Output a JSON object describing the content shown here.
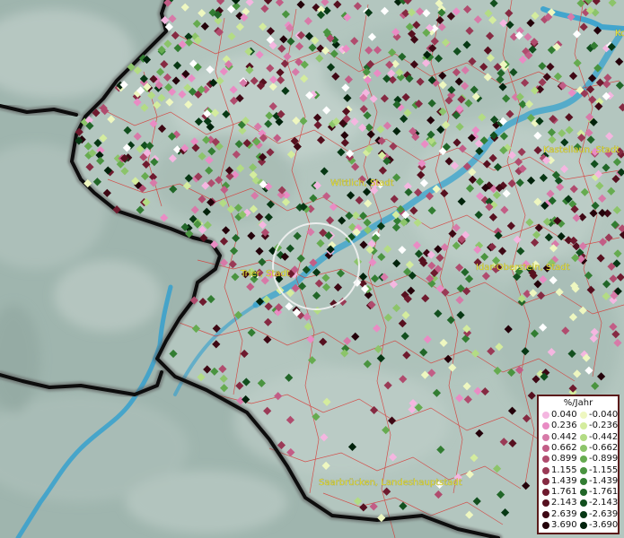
{
  "map": {
    "places": [
      {
        "name": "Wittlich, Stadt"
      },
      {
        "name": "Kastellaun, Stadt"
      },
      {
        "name": "Trier, Stadt"
      },
      {
        "name": "Idar-Oberstein, Stadt"
      },
      {
        "name": "Saarbrücken, Landeshauptstadt"
      },
      {
        "name": "Ko"
      }
    ],
    "colors": {
      "terrain": "#a9bcb6",
      "border": "#111111",
      "admin_lines": "#d9322e",
      "rivers": "#2a9fd0"
    }
  },
  "legend": {
    "title": "%/Jahr",
    "positive": [
      {
        "value": "0.040",
        "color": "#f4b6e0"
      },
      {
        "value": "0.236",
        "color": "#e98cc4"
      },
      {
        "value": "0.442",
        "color": "#d77aa8"
      },
      {
        "value": "0.662",
        "color": "#c25d86"
      },
      {
        "value": "0.899",
        "color": "#b04c6e"
      },
      {
        "value": "1.155",
        "color": "#9a3a56"
      },
      {
        "value": "1.439",
        "color": "#852a42"
      },
      {
        "value": "1.761",
        "color": "#6e1a2e"
      },
      {
        "value": "2.143",
        "color": "#56101f"
      },
      {
        "value": "2.639",
        "color": "#3e0814"
      },
      {
        "value": "3.690",
        "color": "#24020a"
      }
    ],
    "negative": [
      {
        "value": "-0.040",
        "color": "#eef7c0"
      },
      {
        "value": "-0.236",
        "color": "#d4ec9e"
      },
      {
        "value": "-0.442",
        "color": "#b3dc84"
      },
      {
        "value": "-0.662",
        "color": "#8cc46a"
      },
      {
        "value": "-0.899",
        "color": "#66ab50"
      },
      {
        "value": "-1.155",
        "color": "#4a9440"
      },
      {
        "value": "-1.439",
        "color": "#327d32"
      },
      {
        "value": "-1.761",
        "color": "#216628"
      },
      {
        "value": "-2.143",
        "color": "#124f1e"
      },
      {
        "value": "-2.639",
        "color": "#073814"
      },
      {
        "value": "-3.690",
        "color": "#01220b"
      }
    ]
  }
}
